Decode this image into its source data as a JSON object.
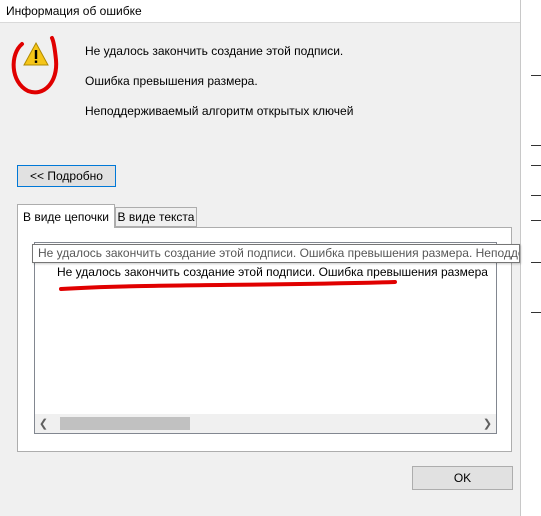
{
  "window": {
    "title": "Информация об ошибке"
  },
  "messages": [
    "Не удалось закончить создание этой подписи.",
    "Ошибка превышения размера.",
    "Неподдерживаемый алгоритм открытых ключей"
  ],
  "details_button": "<< Подробно",
  "tabs": [
    {
      "label": "В виде цепочки",
      "active": true
    },
    {
      "label": "В виде текста",
      "active": false
    }
  ],
  "chain": {
    "item": "Не удалось закончить создание этой подписи.    Ошибка превышения размера",
    "tooltip": "Не удалось закончить создание этой подписи.    Ошибка превышения размера.    Неподдерживаемый алгоритм открытых ключей"
  },
  "ok_button": "OK",
  "colors": {
    "annotation_red": "#e00000",
    "focus_border": "#0078d7",
    "warning_yellow": "#f5c518"
  },
  "icons": {
    "warning": "warning-icon"
  }
}
